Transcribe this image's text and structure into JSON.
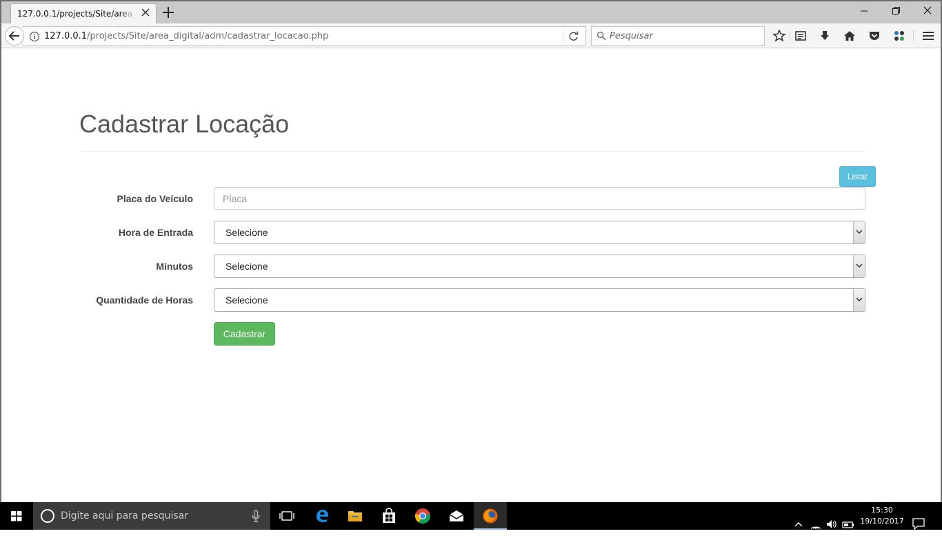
{
  "browser": {
    "tab_title": "127.0.0.1/projects/Site/area_digital/adm/cadastrar_locacao.php",
    "url_host": "127.0.0.1",
    "url_path": "/projects/Site/area_digital/adm/cadastrar_locacao.php",
    "search_placeholder": "Pesquisar"
  },
  "page": {
    "title": "Cadastrar Locação",
    "list_button": "Listar",
    "form": {
      "plate_label": "Placa do Veículo",
      "plate_placeholder": "Placa",
      "entry_hour_label": "Hora de Entrada",
      "entry_hour_value": "Selecione",
      "minutes_label": "Minutos",
      "minutes_value": "Selecione",
      "hours_qty_label": "Quantidade de Horas",
      "hours_qty_value": "Selecione",
      "submit_label": "Cadastrar"
    }
  },
  "taskbar": {
    "search_placeholder": "Digite aqui para pesquisar",
    "time": "15:30",
    "date": "19/10/2017"
  },
  "colors": {
    "info_button": "#5bc0de",
    "success_button": "#5cb85c"
  },
  "icons": [
    "back-icon",
    "info-icon",
    "reload-icon",
    "search-icon",
    "star-icon",
    "reading-list-icon",
    "download-icon",
    "home-icon",
    "pocket-icon",
    "extension-icon",
    "menu-icon",
    "windows-start-icon",
    "cortana-icon",
    "mic-icon",
    "task-view-icon",
    "edge-icon",
    "file-explorer-icon",
    "store-icon",
    "chrome-icon",
    "mail-icon",
    "firefox-icon",
    "chevron-up-icon",
    "wifi-icon",
    "volume-icon",
    "battery-icon",
    "notification-icon"
  ]
}
